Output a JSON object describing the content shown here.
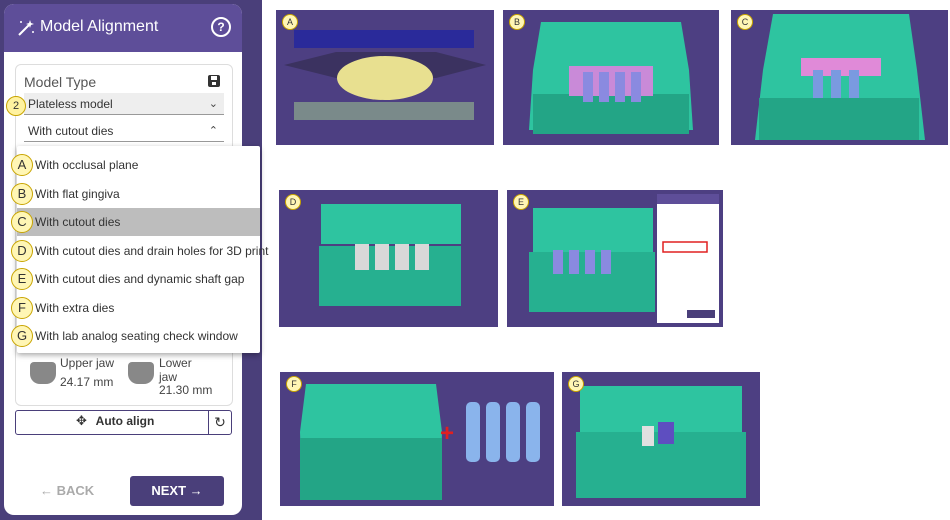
{
  "panel": {
    "title": "Model Alignment",
    "help_icon": "?",
    "model_type_label": "Model Type",
    "step_badge": "2",
    "model_select": "Plateless model",
    "dies_select": "With cutout dies",
    "upper_jaw_label": "Upper jaw",
    "upper_jaw_value": "24.17 mm",
    "lower_jaw_label": "Lower jaw",
    "lower_jaw_value": "21.30 mm",
    "auto_align": "Auto align",
    "back": "BACK",
    "next": "NEXT"
  },
  "dropdown": {
    "options": [
      {
        "badge": "A",
        "label": "With occlusal plane"
      },
      {
        "badge": "B",
        "label": "With flat gingiva"
      },
      {
        "badge": "C",
        "label": "With cutout dies"
      },
      {
        "badge": "D",
        "label": "With cutout dies and drain holes for 3D print"
      },
      {
        "badge": "E",
        "label": "With cutout dies and dynamic shaft gap"
      },
      {
        "badge": "F",
        "label": "With extra dies"
      },
      {
        "badge": "G",
        "label": "With lab analog seating check window"
      }
    ],
    "selected_index": 2
  },
  "previews": [
    {
      "tag": "A"
    },
    {
      "tag": "B"
    },
    {
      "tag": "C"
    },
    {
      "tag": "D"
    },
    {
      "tag": "E"
    },
    {
      "tag": "F"
    },
    {
      "tag": "G"
    }
  ],
  "colors": {
    "accent": "#4a3f7a",
    "header": "#5e4e99",
    "tile_bg": "#4d3f82",
    "model_green": "#2ec4a0",
    "badge_yellow": "#fff6b5"
  }
}
